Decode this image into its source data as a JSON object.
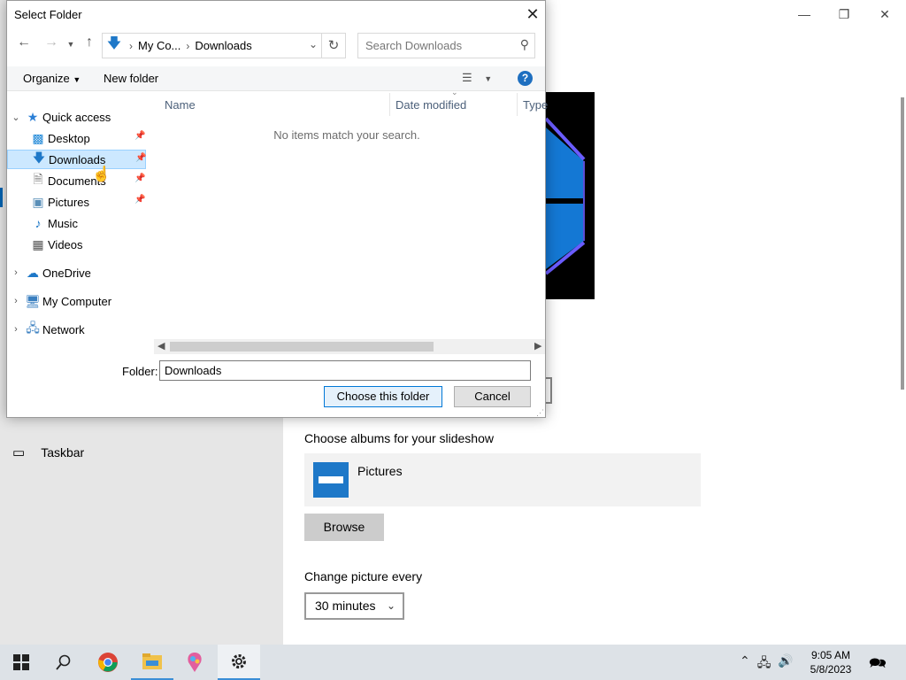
{
  "dialog": {
    "title": "Select Folder",
    "address": {
      "crumb1": "My Co...",
      "crumb2": "Downloads"
    },
    "search_placeholder": "Search Downloads",
    "toolbar": {
      "organize": "Organize",
      "new_folder": "New folder"
    },
    "nav": {
      "quick_access": "Quick access",
      "desktop": "Desktop",
      "downloads": "Downloads",
      "documents": "Documents",
      "pictures": "Pictures",
      "music": "Music",
      "videos": "Videos",
      "onedrive": "OneDrive",
      "my_computer": "My Computer",
      "network": "Network"
    },
    "columns": {
      "name": "Name",
      "date_modified": "Date modified",
      "type": "Type"
    },
    "empty_message": "No items match your search.",
    "folder_label": "Folder:",
    "folder_value": "Downloads",
    "choose_button": "Choose this folder",
    "cancel_button": "Cancel"
  },
  "settings": {
    "nav_taskbar": "Taskbar",
    "albums_label": "Choose albums for your slideshow",
    "album_name": "Pictures",
    "browse_button": "Browse",
    "interval_label": "Change picture every",
    "interval_value": "30 minutes"
  },
  "taskbar": {
    "time": "9:05 AM",
    "date": "5/8/2023",
    "icons": [
      "windows-start-icon",
      "search-icon",
      "chrome-icon",
      "file-explorer-icon",
      "paint-icon",
      "settings-gear-icon"
    ]
  },
  "colors": {
    "accent": "#0078d7",
    "selection": "#cce8ff",
    "taskbar": "#dde2e7"
  }
}
